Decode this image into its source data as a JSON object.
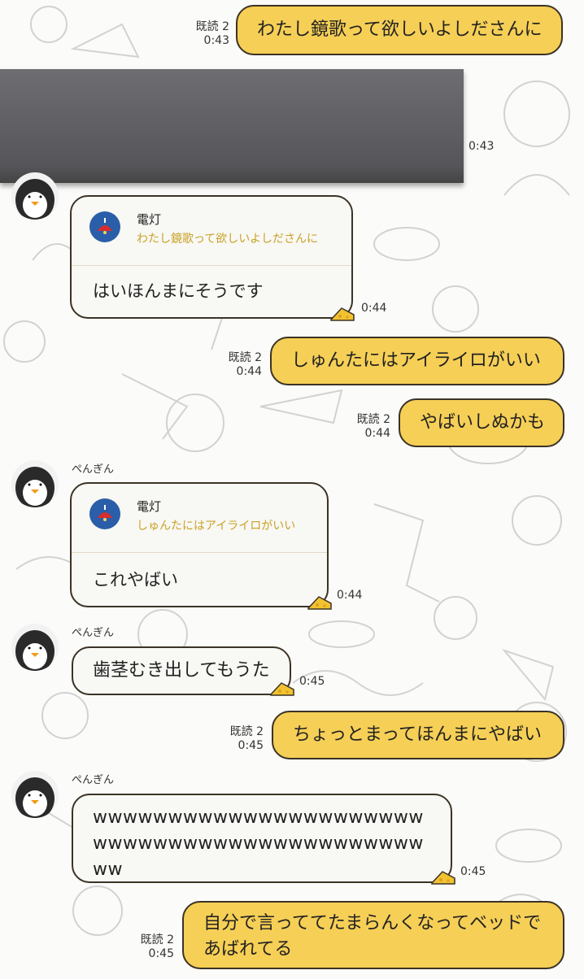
{
  "messages": [
    {
      "id": "m1",
      "side": "right",
      "text": "わたし鏡歌って欲しいよしださんに",
      "read": "既読 2",
      "time": "0:43"
    },
    {
      "id": "m2",
      "side": "right",
      "redacted": true,
      "time": "0:43"
    },
    {
      "id": "m3",
      "side": "left",
      "reply": {
        "name": "電灯",
        "quote": "わたし鏡歌って欲しいよしださんに"
      },
      "text": "はいほんまにそうです",
      "time": "0:44"
    },
    {
      "id": "m4",
      "side": "right",
      "text": "しゅんたにはアイライロがいい",
      "read": "既読 2",
      "time": "0:44"
    },
    {
      "id": "m5",
      "side": "right",
      "text": "やばいしぬかも",
      "read": "既読 2",
      "time": "0:44"
    },
    {
      "id": "m6",
      "side": "left",
      "sender": "ぺんぎん",
      "reply": {
        "name": "電灯",
        "quote": "しゅんたにはアイライロがいい"
      },
      "text": "これやばい",
      "time": "0:44"
    },
    {
      "id": "m7",
      "side": "left",
      "sender": "ぺんぎん",
      "text": "歯茎むき出してもうた",
      "time": "0:45"
    },
    {
      "id": "m8",
      "side": "right",
      "text": "ちょっとまってほんまにやばい",
      "read": "既読 2",
      "time": "0:45"
    },
    {
      "id": "m9",
      "side": "left",
      "sender": "ぺんぎん",
      "lines": [
        "wwwwwwwwwwwwwwwwwwwwww",
        "wwwwwwwwwwwwwwwwwwwwww",
        "ww"
      ],
      "time": "0:45"
    },
    {
      "id": "m10",
      "side": "right",
      "lines": [
        "自分で言っててたまらんくなってベッドで",
        "あばれてる"
      ],
      "read": "既読 2",
      "time": "0:45"
    }
  ],
  "colors": {
    "my_bubble": "#f6cf56",
    "other_bubble": "#f8f8f4",
    "reply_quote": "#c9a227",
    "reply_icon": "#2b5ea8"
  },
  "icons": {
    "avatar": "penguin-avatar-icon",
    "reply": "lamp-icon",
    "sticker": "cheese-icon"
  }
}
